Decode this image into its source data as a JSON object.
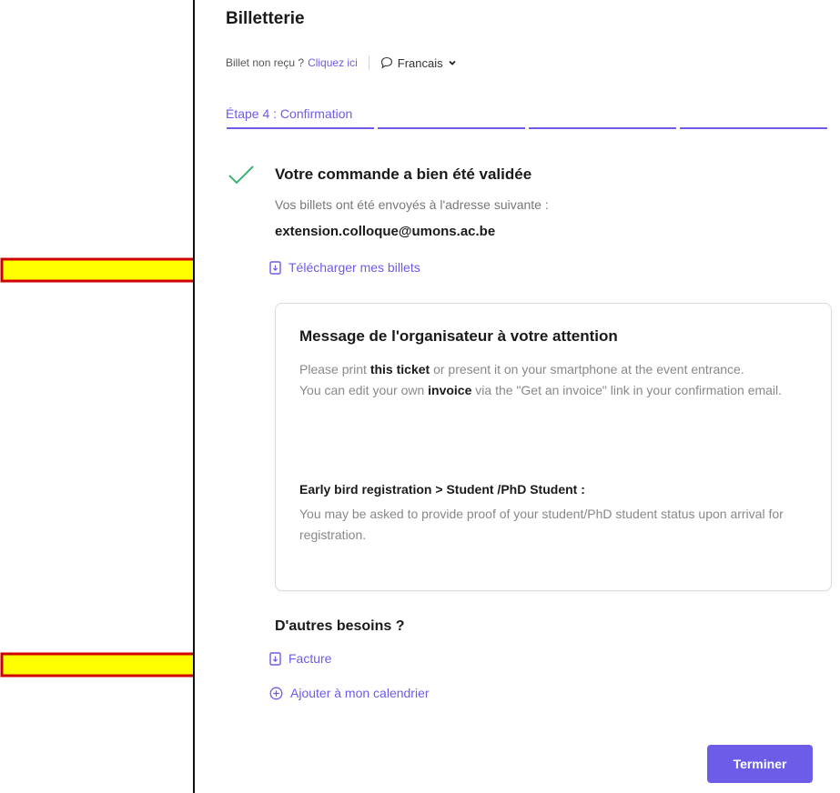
{
  "header": {
    "title": "Billetterie",
    "ticket_not_received": "Billet non reçu ?",
    "click_here": "Cliquez ici",
    "language": "Francais"
  },
  "steps": {
    "current_label": "Étape 4 : Confirmation",
    "count": 4
  },
  "confirmation": {
    "title": "Votre commande a bien été validée",
    "sent_text": "Vos billets ont été envoyés à l'adresse suivante :",
    "email": "extension.colloque@umons.ac.be",
    "download_label": "Télécharger mes billets"
  },
  "organizer_message": {
    "title": "Message de l'organisateur à votre attention",
    "p1_before": "Please print ",
    "p1_bold": "this ticket",
    "p1_after": " or present it on your smartphone at the event entrance.",
    "p2_before": "You can edit your own ",
    "p2_bold": "invoice",
    "p2_after": " via the \"Get an invoice\" link in your confirmation email.",
    "sub_title": "Early bird registration > Student /PhD Student :",
    "sub_body": "You may be asked to provide proof of your student/PhD student status upon arrival for registration."
  },
  "other_needs": {
    "title": "D'autres besoins ?",
    "invoice_label": "Facture",
    "calendar_label": "Ajouter à mon calendrier"
  },
  "actions": {
    "finish_label": "Terminer"
  },
  "colors": {
    "accent": "#6c5ce7",
    "success": "#3cb371",
    "arrow_fill": "#ffff00",
    "arrow_stroke": "#d00000"
  }
}
